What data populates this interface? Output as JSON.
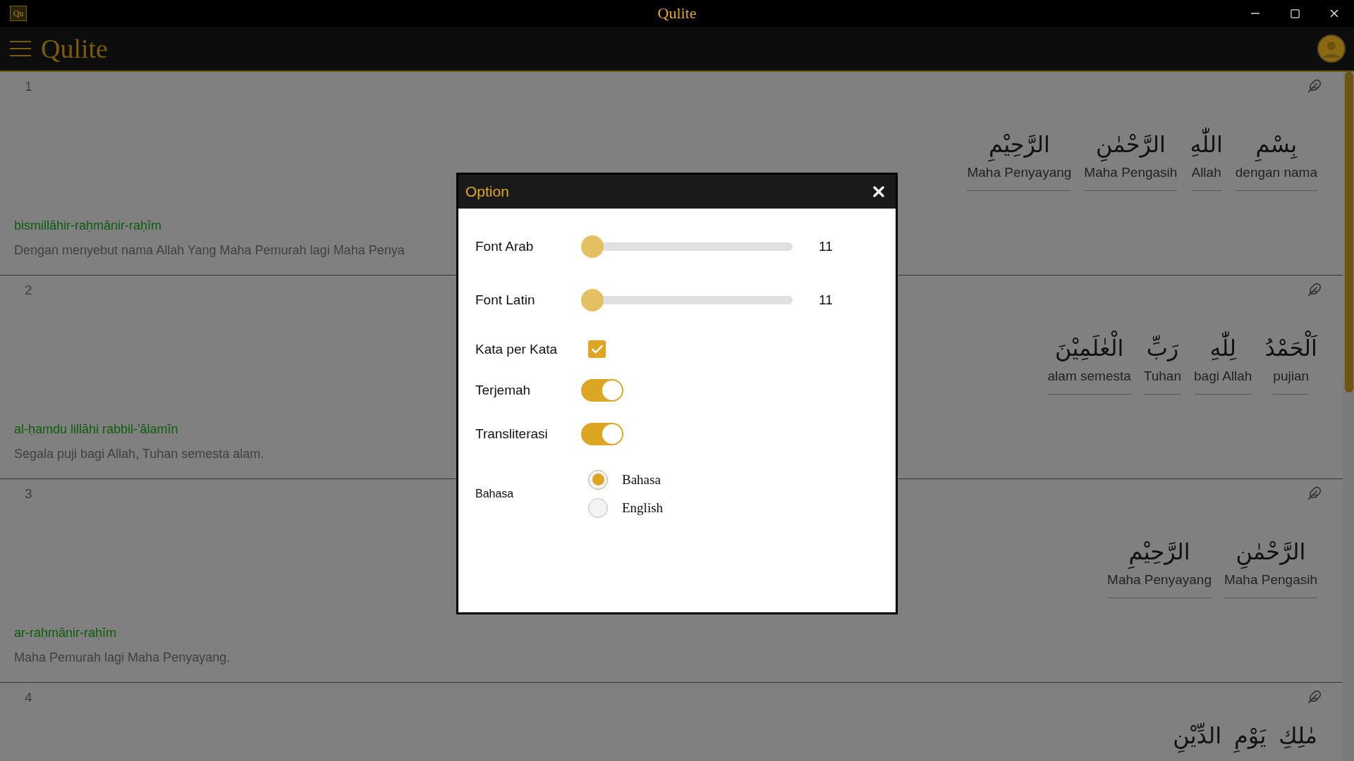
{
  "window": {
    "app_icon": "Qu",
    "title": "Qulite"
  },
  "header": {
    "title": "Qulite"
  },
  "verses": [
    {
      "number": "1",
      "words": [
        {
          "arabic": "بِسْمِ",
          "meaning": "dengan nama"
        },
        {
          "arabic": "اللّٰهِ",
          "meaning": "Allah"
        },
        {
          "arabic": "الرَّحْمٰنِ",
          "meaning": "Maha Pengasih"
        },
        {
          "arabic": "الرَّحِيْمِ",
          "meaning": "Maha Penyayang"
        }
      ],
      "transliteration": "bismillāhir-raḥmānir-raḥīm",
      "translation": "Dengan menyebut nama Allah Yang Maha Pemurah lagi Maha Penya"
    },
    {
      "number": "2",
      "words": [
        {
          "arabic": "اَلْحَمْدُ",
          "meaning": "pujian"
        },
        {
          "arabic": "لِلّٰهِ",
          "meaning": "bagi Allah"
        },
        {
          "arabic": "رَبِّ",
          "meaning": "Tuhan"
        },
        {
          "arabic": "الْعٰلَمِيْنَ",
          "meaning": "alam semesta"
        }
      ],
      "transliteration": "al-ḥamdu lillāhi rabbil-'ālamīn",
      "translation": "Segala puji bagi Allah, Tuhan semesta alam."
    },
    {
      "number": "3",
      "words": [
        {
          "arabic": "الرَّحْمٰنِ",
          "meaning": "Maha Pengasih"
        },
        {
          "arabic": "الرَّحِيْمِ",
          "meaning": "Maha Penyayang"
        }
      ],
      "transliteration": "ar-raḥmānir-raḥīm",
      "translation": "Maha Pemurah lagi Maha Penyayang."
    },
    {
      "number": "4",
      "words": [
        {
          "arabic": "مٰلِكِ"
        },
        {
          "arabic": "يَوْمِ"
        },
        {
          "arabic": "الدِّيْنِ"
        }
      ]
    }
  ],
  "dialog": {
    "title": "Option",
    "settings": [
      {
        "kind": "slider",
        "label": "Font Arab",
        "level": 0,
        "reading": "11"
      },
      {
        "kind": "slider",
        "label": "Font Latin",
        "level": 0,
        "reading": "11"
      },
      {
        "kind": "checkbox",
        "label": "Kata per Kata",
        "checked": true
      },
      {
        "kind": "toggle",
        "label": "Terjemah",
        "on": true
      },
      {
        "kind": "toggle",
        "label": "Transliterasi",
        "on": true
      },
      {
        "kind": "radio",
        "label": "Bahasa",
        "options": [
          {
            "label": "Bahasa",
            "selected": true
          },
          {
            "label": "English",
            "selected": false
          }
        ]
      }
    ]
  }
}
